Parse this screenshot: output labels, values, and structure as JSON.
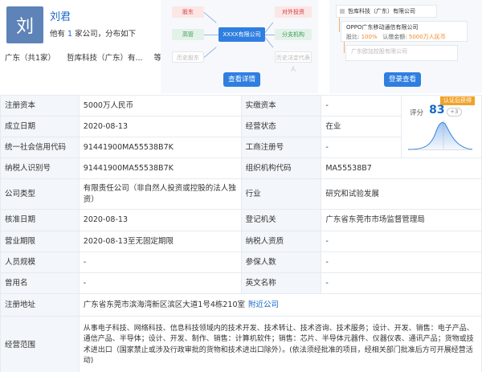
{
  "person": {
    "avatar_char": "刘",
    "name": "刘君",
    "summary_prefix": "他有",
    "summary_count": "1",
    "summary_suffix": "家公司，分布如下",
    "region": "广东（共1家）",
    "company_short": "哲库科技（广东）有...",
    "etc": "等"
  },
  "relation_chart": {
    "shareholder": "股东",
    "executive": "高管",
    "history_shareholder": "历史股东",
    "company": "XXXX有限公司",
    "investment": "对外投资",
    "branch": "分支机构",
    "history_rep": "历史法定代表人",
    "button": "查看详情"
  },
  "equity_tree": {
    "root": "哲库科技（广东）有限公司",
    "child_title": "OPPO广东移动通信有限公司",
    "ratio_label": "股比:",
    "ratio_value": "100%",
    "capital_label": "认缴金额:",
    "capital_value": "5000万人民币",
    "grandchild": "广东欧加控股有限公司",
    "button": "登录查看"
  },
  "score_panel": {
    "badge": "认证后获得",
    "label": "评分",
    "value": "83",
    "plus": "+3"
  },
  "rows": [
    {
      "k1": "注册资本",
      "v1": "5000万人民币",
      "k2": "实缴资本",
      "v2": "-"
    },
    {
      "k1": "成立日期",
      "v1": "2020-08-13",
      "k2": "经营状态",
      "v2": "在业"
    },
    {
      "k1": "统一社会信用代码",
      "v1": "91441900MA55538B7K",
      "k2": "工商注册号",
      "v2": "-"
    },
    {
      "k1": "纳税人识别号",
      "v1": "91441900MA55538B7K",
      "k2": "组织机构代码",
      "v2": "MA55538B7"
    },
    {
      "k1": "公司类型",
      "v1": "有限责任公司（非自然人投资或控股的法人独资）",
      "k2": "行业",
      "v2": "研究和试验发展"
    },
    {
      "k1": "核准日期",
      "v1": "2020-08-13",
      "k2": "登记机关",
      "v2": "广东省东莞市市场监督管理局"
    },
    {
      "k1": "营业期限",
      "v1": "2020-08-13至无固定期限",
      "k2": "纳税人资质",
      "v2": "-"
    },
    {
      "k1": "人员规模",
      "v1": "-",
      "k2": "参保人数",
      "v2": "-"
    },
    {
      "k1": "曾用名",
      "v1": "-",
      "k2": "英文名称",
      "v2": "-"
    }
  ],
  "address": {
    "label": "注册地址",
    "value": "广东省东莞市滨海湾新区滨区大道1号4栋210室",
    "link": "附近公司"
  },
  "scope": {
    "label": "经营范围",
    "value": "从事电子科技、网络科技、信息科技领域内的技术开发、技术转让、技术咨询、技术服务；设计、开发、销售：电子产品、通信产品、半导体；设计、开发、制作、销售：计算机软件；销售：芯片、半导体元器件、仪器仪表、通讯产品；货物或技术进出口（国家禁止或涉及行政审批的货物和技术进出口除外）。(依法须经批准的项目，经相关部门批准后方可开展经营活动)"
  }
}
